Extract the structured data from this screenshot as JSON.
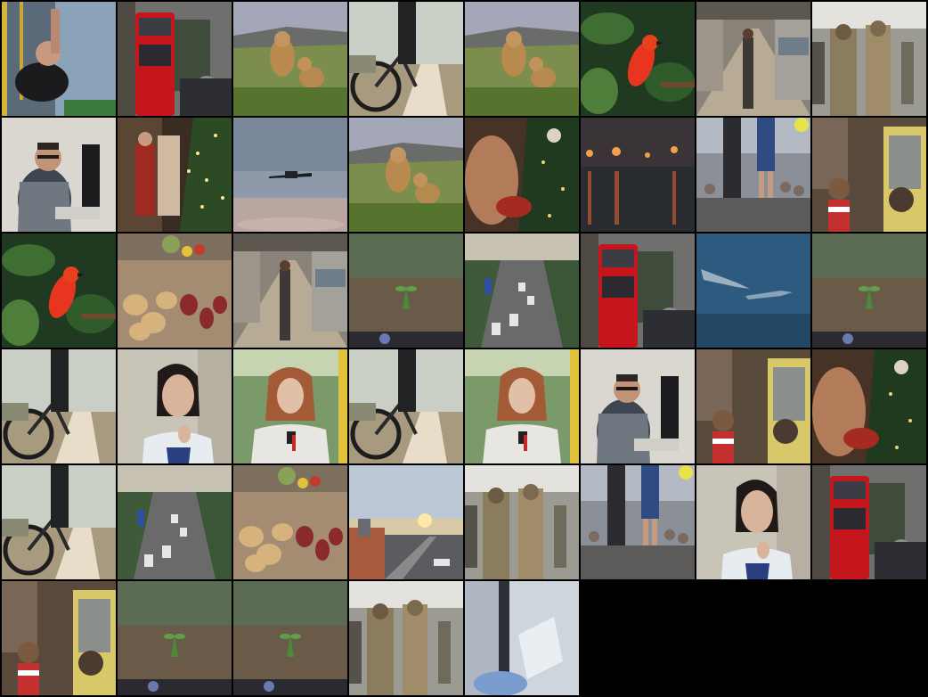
{
  "grid": {
    "rows": 6,
    "cols": 8,
    "tiles": [
      {
        "subject": "gym-pullup"
      },
      {
        "subject": "london-bus"
      },
      {
        "subject": "lions"
      },
      {
        "subject": "bicycle-trail"
      },
      {
        "subject": "lions"
      },
      {
        "subject": "red-bird"
      },
      {
        "subject": "train-platform"
      },
      {
        "subject": "soldiers"
      },
      {
        "subject": "man-laptop"
      },
      {
        "subject": "christmas-shop"
      },
      {
        "subject": "airplane"
      },
      {
        "subject": "lions"
      },
      {
        "subject": "christmas-tree-closeup"
      },
      {
        "subject": "city-night-rain"
      },
      {
        "subject": "runners"
      },
      {
        "subject": "child-bus"
      },
      {
        "subject": "red-bird"
      },
      {
        "subject": "vegetables"
      },
      {
        "subject": "train-platform"
      },
      {
        "subject": "sprout-soil"
      },
      {
        "subject": "traffic-avenue"
      },
      {
        "subject": "london-bus"
      },
      {
        "subject": "sharks"
      },
      {
        "subject": "sprout-soil"
      },
      {
        "subject": "bicycle-trail"
      },
      {
        "subject": "woman-thinking"
      },
      {
        "subject": "woman-phone"
      },
      {
        "subject": "bicycle-trail"
      },
      {
        "subject": "woman-phone"
      },
      {
        "subject": "man-laptop"
      },
      {
        "subject": "child-bus"
      },
      {
        "subject": "christmas-tree-closeup"
      },
      {
        "subject": "bicycle-trail"
      },
      {
        "subject": "traffic-avenue"
      },
      {
        "subject": "vegetables"
      },
      {
        "subject": "city-sunset"
      },
      {
        "subject": "soldiers"
      },
      {
        "subject": "runners"
      },
      {
        "subject": "woman-thinking"
      },
      {
        "subject": "london-bus"
      },
      {
        "subject": "child-bus"
      },
      {
        "subject": "sprout-soil"
      },
      {
        "subject": "sprout-soil"
      },
      {
        "subject": "soldiers"
      },
      {
        "subject": "lab-glove"
      },
      {
        "subject": "empty"
      },
      {
        "subject": "empty"
      },
      {
        "subject": "empty"
      }
    ]
  }
}
